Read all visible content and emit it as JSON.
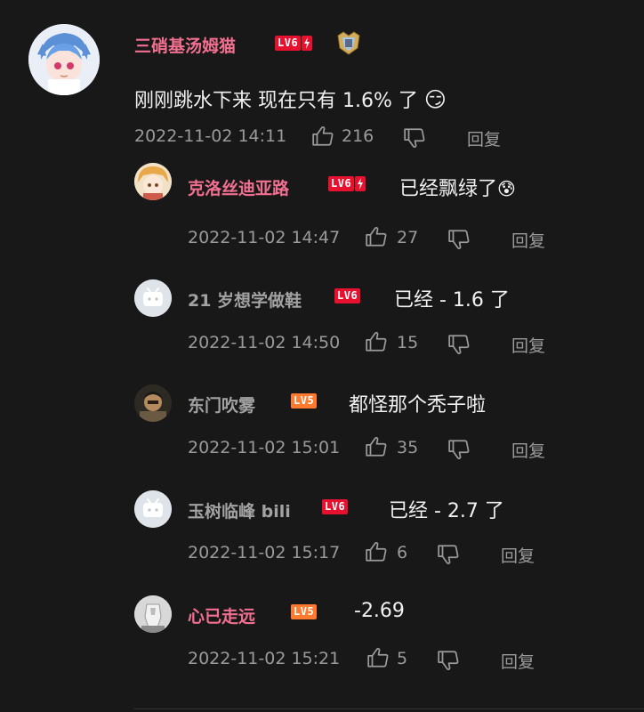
{
  "main_comment": {
    "username": "三硝基汤姆猫",
    "level": "LV6",
    "text": "刚刚跳水下来 现在只有 1.6% 了",
    "emoji": "😏",
    "time": "2022-11-02 14:11",
    "likes": "216",
    "reply_label": "回复"
  },
  "replies": [
    {
      "username": "克洛丝迪亚路",
      "level": "LV6",
      "text": "已经飘绿了",
      "emoji": "😰",
      "time": "2022-11-02 14:47",
      "likes": "27",
      "reply_label": "回复"
    },
    {
      "username": "21 岁想学做鞋",
      "level": "LV6",
      "text": "已经 - 1.6 了",
      "time": "2022-11-02 14:50",
      "likes": "15",
      "reply_label": "回复"
    },
    {
      "username": "东门吹雾",
      "level": "LV5",
      "text": "都怪那个秃子啦",
      "time": "2022-11-02 15:01",
      "likes": "35",
      "reply_label": "回复"
    },
    {
      "username": "玉树临峰 bili",
      "level": "LV6",
      "text": "已经 - 2.7 了",
      "time": "2022-11-02 15:17",
      "likes": "6",
      "reply_label": "回复"
    },
    {
      "username": "心已走远",
      "level": "LV5",
      "text": "-2.69",
      "time": "2022-11-02 15:21",
      "likes": "5",
      "reply_label": "回复"
    }
  ],
  "colors": {
    "username_vip": "#f16f8f",
    "username_normal": "#a2a2a2",
    "lv6": "#e8102f",
    "lv5": "#ff7a2e",
    "background": "#181818"
  },
  "icons": [
    "thumbs-up-icon",
    "thumbs-down-icon",
    "lightning-icon",
    "medal-badge-icon",
    "tv-avatar-icon"
  ]
}
